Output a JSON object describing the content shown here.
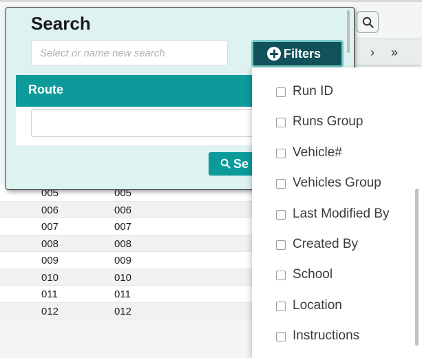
{
  "search_panel": {
    "title": "Search",
    "name_placeholder": "Select or name new search",
    "filters_label": "Filters",
    "route_label": "Route",
    "route_value": "",
    "search_button_label": "Se"
  },
  "pager": {
    "next": "›",
    "last": "»"
  },
  "table_rows": [
    {
      "a": "005",
      "b": "005"
    },
    {
      "a": "006",
      "b": "006"
    },
    {
      "a": "007",
      "b": "007"
    },
    {
      "a": "008",
      "b": "008"
    },
    {
      "a": "009",
      "b": "009"
    },
    {
      "a": "010",
      "b": "010"
    },
    {
      "a": "011",
      "b": "011"
    },
    {
      "a": "012",
      "b": "012"
    }
  ],
  "filter_options": [
    "Run ID",
    "Runs Group",
    "Vehicle#",
    "Vehicles Group",
    "Last Modified By",
    "Created By",
    "School",
    "Location",
    "Instructions"
  ],
  "colors": {
    "accent": "#0c9a9a",
    "filters_button": "#10515a",
    "panel_bg": "#dff2f2"
  }
}
